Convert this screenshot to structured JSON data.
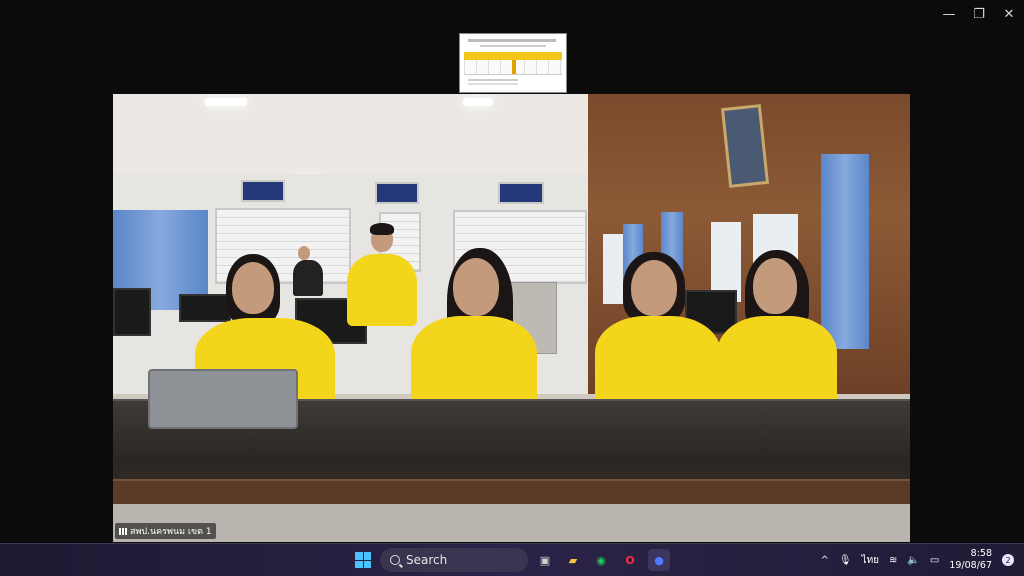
{
  "window": {
    "controls": [
      {
        "name": "minimize",
        "glyph": "—"
      },
      {
        "name": "restore",
        "glyph": "❐"
      },
      {
        "name": "close",
        "glyph": "✕"
      }
    ]
  },
  "video": {
    "participant_label": "สพป.นครพนม เขต 1"
  },
  "taskbar": {
    "search_label": "Search",
    "apps": [
      {
        "name": "task-view",
        "glyph": "▣",
        "color": "#d0d0d0"
      },
      {
        "name": "file-explorer",
        "glyph": "▰",
        "color": "#f4c542"
      },
      {
        "name": "line",
        "glyph": "◉",
        "color": "#1fc95a"
      },
      {
        "name": "opera",
        "glyph": "O",
        "color": "#ff2e3f"
      },
      {
        "name": "meeting-app",
        "glyph": "●",
        "color": "#4c7bff"
      }
    ],
    "tray": {
      "chevron": "^",
      "language": "ไทย",
      "time": "8:58",
      "date": "19/08/67",
      "notification_count": "2"
    }
  },
  "colors": {
    "taskbar_bg": "#2b2347",
    "accent": "#4cc2ff",
    "shirt_yellow": "#f3d51c"
  }
}
